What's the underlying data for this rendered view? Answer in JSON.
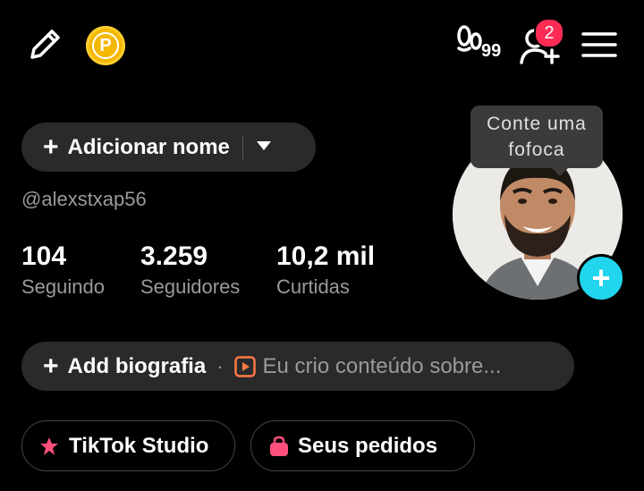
{
  "topbar": {
    "edit_icon": "pencil-icon",
    "coin_icon": "coin-icon",
    "coin_letter": "P",
    "views_icon": "footprints-icon",
    "views_count": "99",
    "friend_icon": "add-friend-icon",
    "friend_badge": "2",
    "menu_icon": "hamburger-menu-icon"
  },
  "profile": {
    "add_name_label": "Adicionar nome",
    "username": "@alexstxap56",
    "stats": [
      {
        "value": "104",
        "label": "Seguindo"
      },
      {
        "value": "3.259",
        "label": "Seguidores"
      },
      {
        "value": "10,2 mil",
        "label": "Curtidas"
      }
    ],
    "bio_label": "Add biografia",
    "bio_separator": "·",
    "bio_placeholder": "Eu crio conteúdo sobre..."
  },
  "avatar": {
    "tooltip_line1": "Conte uma",
    "tooltip_line2": "fofoca",
    "add_label": "+"
  },
  "actions": [
    {
      "label": "TikTok Studio",
      "icon": "studio-icon"
    },
    {
      "label": "Seus pedidos",
      "icon": "shopping-bag-icon"
    }
  ],
  "colors": {
    "accent_red": "#fe2c55",
    "accent_cyan": "#20d5ec",
    "coin": "#f5b800",
    "pill_bg": "#2a2a2a"
  }
}
